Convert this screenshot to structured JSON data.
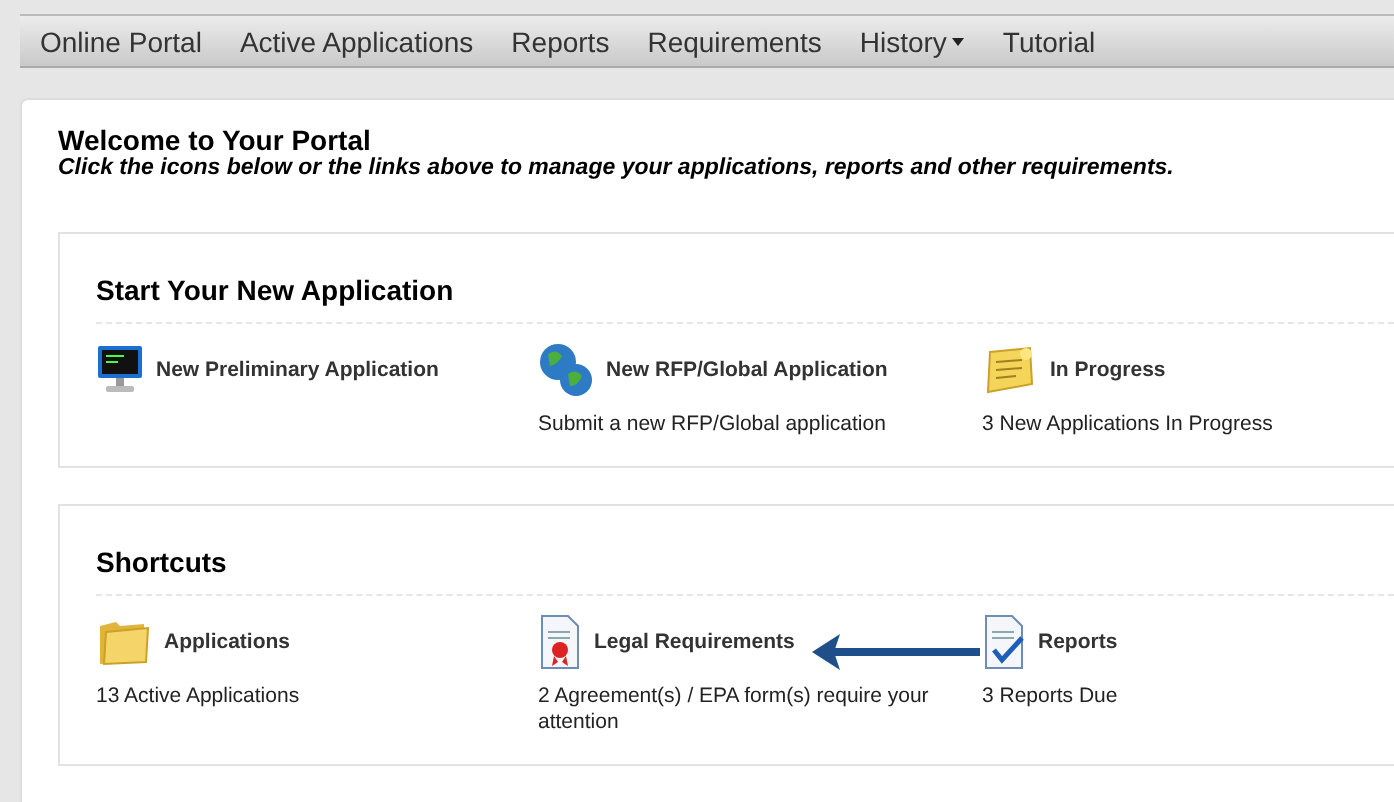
{
  "nav": [
    {
      "label": "Online Portal",
      "dropdown": false
    },
    {
      "label": "Active Applications",
      "dropdown": false
    },
    {
      "label": "Reports",
      "dropdown": false
    },
    {
      "label": "Requirements",
      "dropdown": false
    },
    {
      "label": "History",
      "dropdown": true
    },
    {
      "label": "Tutorial",
      "dropdown": false
    }
  ],
  "welcome": {
    "title": "Welcome to Your Portal",
    "subtitle": "Click the icons below or the links above to manage your applications, reports and other requirements."
  },
  "sections": [
    {
      "title": "Start Your New Application",
      "items": [
        {
          "label": "New Preliminary Application"
        },
        {
          "label": "New RFP/Global Application",
          "description": "Submit a new RFP/Global application"
        },
        {
          "label": "In Progress",
          "description": "3 New Applications In Progress"
        }
      ]
    },
    {
      "title": "Shortcuts",
      "items": [
        {
          "label": "Applications",
          "description": "13 Active Applications"
        },
        {
          "label": "Legal Requirements",
          "description": "2 Agreement(s) / EPA form(s) require your attention"
        },
        {
          "label": "Reports",
          "description": "3 Reports Due"
        }
      ]
    }
  ]
}
